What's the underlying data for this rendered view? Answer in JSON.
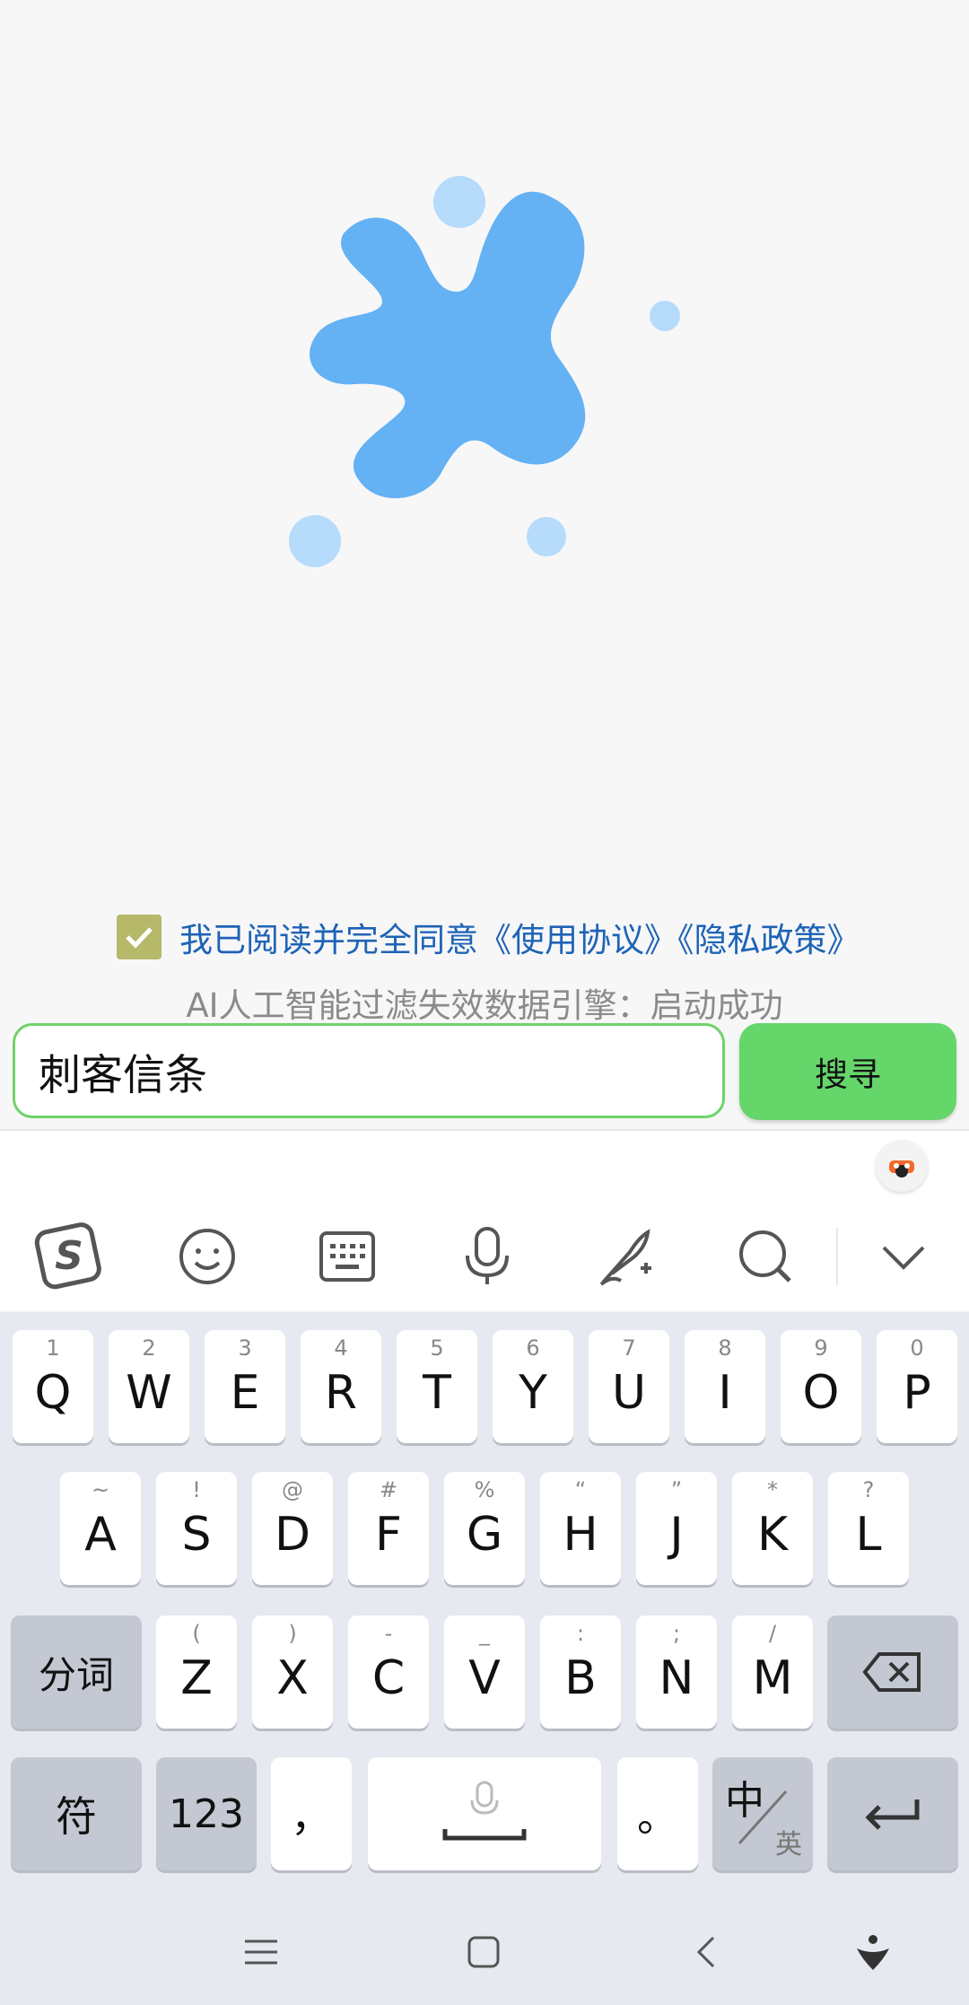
{
  "colors": {
    "accent_green": "#65d66a",
    "link_blue": "#1e63b6",
    "logo_blue": "#64b1f4"
  },
  "agreement": {
    "checked": true,
    "text": "我已阅读并完全同意《使用协议》《隐私政策》"
  },
  "status_text": "AI人工智能过滤失效数据引擎：启动成功",
  "search": {
    "value": "刺客信条",
    "button_label": "搜寻"
  },
  "toolbar": {
    "icons": [
      "sogou-logo-icon",
      "emoji-icon",
      "keyboard-icon",
      "microphone-icon",
      "handwriting-icon",
      "search-icon",
      "chevron-down-icon"
    ]
  },
  "keyboard": {
    "row1": [
      {
        "sub": "1",
        "main": "Q"
      },
      {
        "sub": "2",
        "main": "W"
      },
      {
        "sub": "3",
        "main": "E"
      },
      {
        "sub": "4",
        "main": "R"
      },
      {
        "sub": "5",
        "main": "T"
      },
      {
        "sub": "6",
        "main": "Y"
      },
      {
        "sub": "7",
        "main": "U"
      },
      {
        "sub": "8",
        "main": "I"
      },
      {
        "sub": "9",
        "main": "O"
      },
      {
        "sub": "0",
        "main": "P"
      }
    ],
    "row2": [
      {
        "sub": "~",
        "main": "A"
      },
      {
        "sub": "!",
        "main": "S"
      },
      {
        "sub": "@",
        "main": "D"
      },
      {
        "sub": "#",
        "main": "F"
      },
      {
        "sub": "%",
        "main": "G"
      },
      {
        "sub": "“",
        "main": "H"
      },
      {
        "sub": "”",
        "main": "J"
      },
      {
        "sub": "*",
        "main": "K"
      },
      {
        "sub": "?",
        "main": "L"
      }
    ],
    "row3": [
      {
        "sub": "(",
        "main": "Z"
      },
      {
        "sub": ")",
        "main": "X"
      },
      {
        "sub": "-",
        "main": "C"
      },
      {
        "sub": "_",
        "main": "V"
      },
      {
        "sub": ":",
        "main": "B"
      },
      {
        "sub": ";",
        "main": "N"
      },
      {
        "sub": "/",
        "main": "M"
      }
    ],
    "fenci": "分词",
    "fu": "符",
    "num": "123",
    "comma": "，",
    "period": "。",
    "lang_main": "中",
    "lang_sub": "英"
  },
  "navbar": {
    "icons": [
      "menu-icon",
      "home-icon",
      "back-icon",
      "assistant-icon"
    ]
  }
}
